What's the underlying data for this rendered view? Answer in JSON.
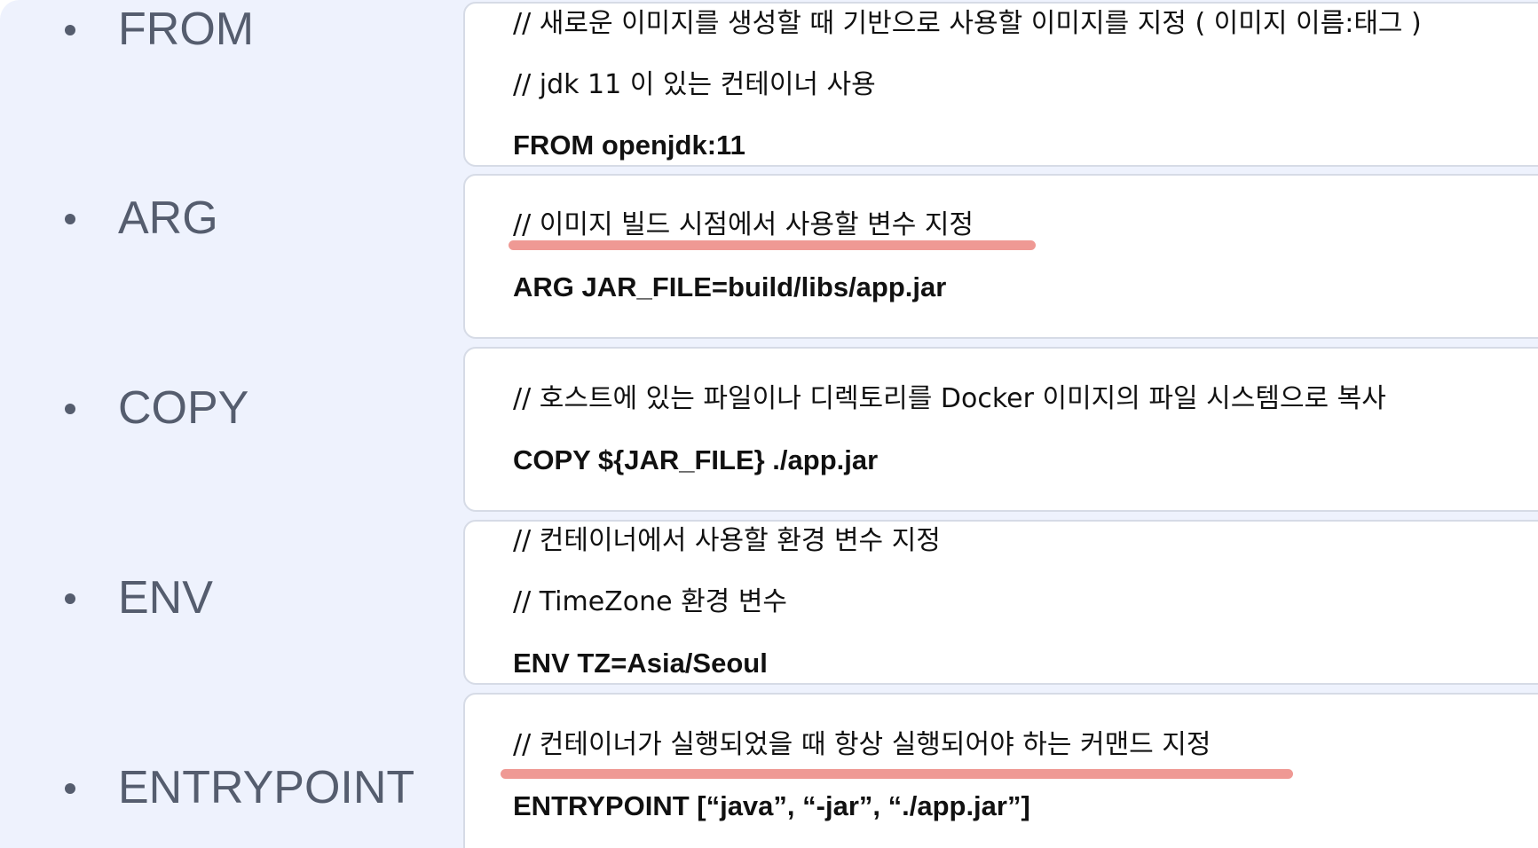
{
  "instructions": [
    {
      "keyword": "FROM",
      "lines": [
        "// 새로운 이미지를 생성할 때 기반으로 사용할 이미지를 지정 ( 이미지 이름:태그 )",
        "// jdk 11 이 있는 컨테이너 사용"
      ],
      "code": "FROM openjdk:11"
    },
    {
      "keyword": "ARG",
      "lines": [
        "// 이미지 빌드 시점에서 사용할 변수 지정"
      ],
      "code": "ARG JAR_FILE=build/libs/app.jar"
    },
    {
      "keyword": "COPY",
      "lines": [
        "// 호스트에 있는 파일이나 디렉토리를 Docker 이미지의 파일 시스템으로 복사"
      ],
      "code": "COPY ${JAR_FILE} ./app.jar"
    },
    {
      "keyword": "ENV",
      "lines": [
        "// 컨테이너에서 사용할 환경 변수 지정",
        "// TimeZone 환경 변수"
      ],
      "code": "ENV TZ=Asia/Seoul"
    },
    {
      "keyword": "ENTRYPOINT",
      "lines": [
        "// 컨테이너가 실행되었을 때 항상 실행되어야 하는 커맨드 지정"
      ],
      "code": "ENTRYPOINT [“java”, “-jar”, “./app.jar”]"
    }
  ],
  "colors": {
    "panel_background": "#eef2fd",
    "bullet_text": "#555d6e",
    "card_border": "#d6dbe6",
    "highlight_underline": "#ef9994"
  }
}
